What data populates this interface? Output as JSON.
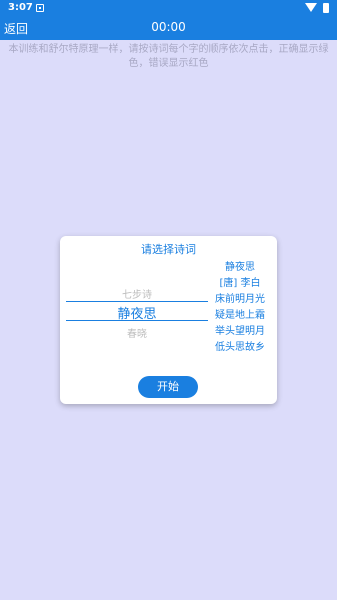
{
  "status_bar": {
    "time": "3:07"
  },
  "app_bar": {
    "back_label": "返回",
    "timer": "00:00"
  },
  "instructions": "本训练和舒尔特原理一样，请按诗词每个字的顺序依次点击，正确显示绿色，错误显示红色",
  "dialog": {
    "title": "请选择诗词",
    "picker": {
      "prev": "七步诗",
      "selected": "静夜思",
      "next": "春晓"
    },
    "poem": {
      "title": "静夜思",
      "author": "[唐] 李白",
      "lines": [
        "床前明月光",
        "疑是地上霜",
        "举头望明月",
        "低头思故乡"
      ]
    },
    "start_label": "开始"
  },
  "colors": {
    "accent": "#1a7fe0",
    "background": "#dcdcfa",
    "hint": "#a8a8c4"
  }
}
